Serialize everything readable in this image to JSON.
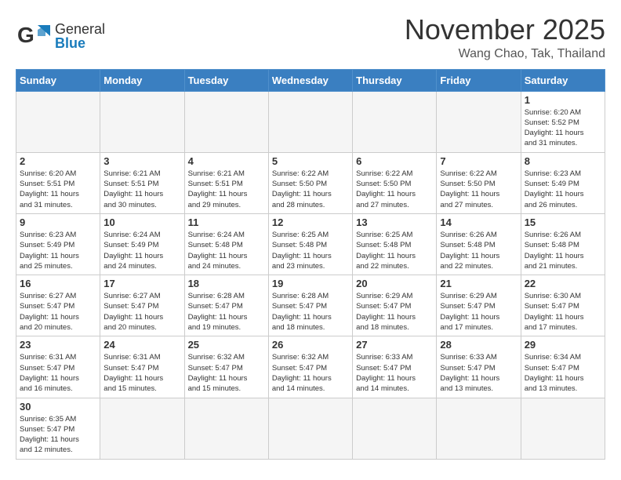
{
  "header": {
    "logo_general": "General",
    "logo_blue": "Blue",
    "main_title": "November 2025",
    "sub_title": "Wang Chao, Tak, Thailand"
  },
  "weekdays": [
    "Sunday",
    "Monday",
    "Tuesday",
    "Wednesday",
    "Thursday",
    "Friday",
    "Saturday"
  ],
  "weeks": [
    [
      {
        "day": "",
        "info": ""
      },
      {
        "day": "",
        "info": ""
      },
      {
        "day": "",
        "info": ""
      },
      {
        "day": "",
        "info": ""
      },
      {
        "day": "",
        "info": ""
      },
      {
        "day": "",
        "info": ""
      },
      {
        "day": "1",
        "info": "Sunrise: 6:20 AM\nSunset: 5:52 PM\nDaylight: 11 hours\nand 31 minutes."
      }
    ],
    [
      {
        "day": "2",
        "info": "Sunrise: 6:20 AM\nSunset: 5:51 PM\nDaylight: 11 hours\nand 31 minutes."
      },
      {
        "day": "3",
        "info": "Sunrise: 6:21 AM\nSunset: 5:51 PM\nDaylight: 11 hours\nand 30 minutes."
      },
      {
        "day": "4",
        "info": "Sunrise: 6:21 AM\nSunset: 5:51 PM\nDaylight: 11 hours\nand 29 minutes."
      },
      {
        "day": "5",
        "info": "Sunrise: 6:22 AM\nSunset: 5:50 PM\nDaylight: 11 hours\nand 28 minutes."
      },
      {
        "day": "6",
        "info": "Sunrise: 6:22 AM\nSunset: 5:50 PM\nDaylight: 11 hours\nand 27 minutes."
      },
      {
        "day": "7",
        "info": "Sunrise: 6:22 AM\nSunset: 5:50 PM\nDaylight: 11 hours\nand 27 minutes."
      },
      {
        "day": "8",
        "info": "Sunrise: 6:23 AM\nSunset: 5:49 PM\nDaylight: 11 hours\nand 26 minutes."
      }
    ],
    [
      {
        "day": "9",
        "info": "Sunrise: 6:23 AM\nSunset: 5:49 PM\nDaylight: 11 hours\nand 25 minutes."
      },
      {
        "day": "10",
        "info": "Sunrise: 6:24 AM\nSunset: 5:49 PM\nDaylight: 11 hours\nand 24 minutes."
      },
      {
        "day": "11",
        "info": "Sunrise: 6:24 AM\nSunset: 5:48 PM\nDaylight: 11 hours\nand 24 minutes."
      },
      {
        "day": "12",
        "info": "Sunrise: 6:25 AM\nSunset: 5:48 PM\nDaylight: 11 hours\nand 23 minutes."
      },
      {
        "day": "13",
        "info": "Sunrise: 6:25 AM\nSunset: 5:48 PM\nDaylight: 11 hours\nand 22 minutes."
      },
      {
        "day": "14",
        "info": "Sunrise: 6:26 AM\nSunset: 5:48 PM\nDaylight: 11 hours\nand 22 minutes."
      },
      {
        "day": "15",
        "info": "Sunrise: 6:26 AM\nSunset: 5:48 PM\nDaylight: 11 hours\nand 21 minutes."
      }
    ],
    [
      {
        "day": "16",
        "info": "Sunrise: 6:27 AM\nSunset: 5:47 PM\nDaylight: 11 hours\nand 20 minutes."
      },
      {
        "day": "17",
        "info": "Sunrise: 6:27 AM\nSunset: 5:47 PM\nDaylight: 11 hours\nand 20 minutes."
      },
      {
        "day": "18",
        "info": "Sunrise: 6:28 AM\nSunset: 5:47 PM\nDaylight: 11 hours\nand 19 minutes."
      },
      {
        "day": "19",
        "info": "Sunrise: 6:28 AM\nSunset: 5:47 PM\nDaylight: 11 hours\nand 18 minutes."
      },
      {
        "day": "20",
        "info": "Sunrise: 6:29 AM\nSunset: 5:47 PM\nDaylight: 11 hours\nand 18 minutes."
      },
      {
        "day": "21",
        "info": "Sunrise: 6:29 AM\nSunset: 5:47 PM\nDaylight: 11 hours\nand 17 minutes."
      },
      {
        "day": "22",
        "info": "Sunrise: 6:30 AM\nSunset: 5:47 PM\nDaylight: 11 hours\nand 17 minutes."
      }
    ],
    [
      {
        "day": "23",
        "info": "Sunrise: 6:31 AM\nSunset: 5:47 PM\nDaylight: 11 hours\nand 16 minutes."
      },
      {
        "day": "24",
        "info": "Sunrise: 6:31 AM\nSunset: 5:47 PM\nDaylight: 11 hours\nand 15 minutes."
      },
      {
        "day": "25",
        "info": "Sunrise: 6:32 AM\nSunset: 5:47 PM\nDaylight: 11 hours\nand 15 minutes."
      },
      {
        "day": "26",
        "info": "Sunrise: 6:32 AM\nSunset: 5:47 PM\nDaylight: 11 hours\nand 14 minutes."
      },
      {
        "day": "27",
        "info": "Sunrise: 6:33 AM\nSunset: 5:47 PM\nDaylight: 11 hours\nand 14 minutes."
      },
      {
        "day": "28",
        "info": "Sunrise: 6:33 AM\nSunset: 5:47 PM\nDaylight: 11 hours\nand 13 minutes."
      },
      {
        "day": "29",
        "info": "Sunrise: 6:34 AM\nSunset: 5:47 PM\nDaylight: 11 hours\nand 13 minutes."
      }
    ],
    [
      {
        "day": "30",
        "info": "Sunrise: 6:35 AM\nSunset: 5:47 PM\nDaylight: 11 hours\nand 12 minutes."
      },
      {
        "day": "",
        "info": ""
      },
      {
        "day": "",
        "info": ""
      },
      {
        "day": "",
        "info": ""
      },
      {
        "day": "",
        "info": ""
      },
      {
        "day": "",
        "info": ""
      },
      {
        "day": "",
        "info": ""
      }
    ]
  ]
}
